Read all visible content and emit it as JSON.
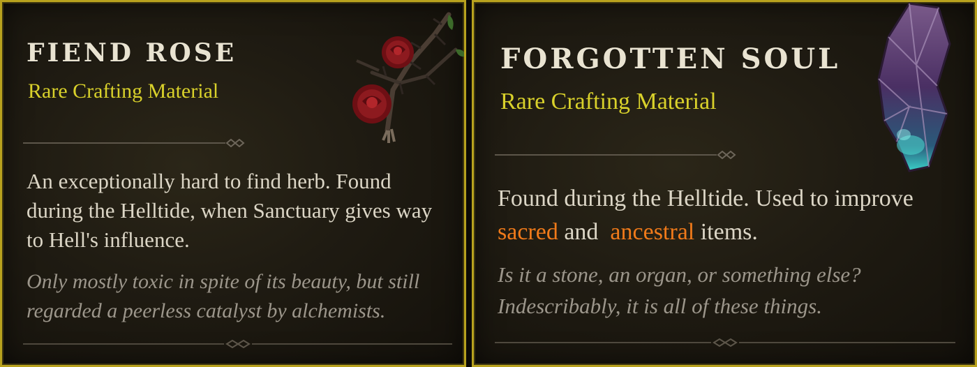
{
  "items": [
    {
      "title": "FIEND ROSE",
      "subtitle": "Rare Crafting Material",
      "description": "An exceptionally hard to find herb. Found during the Helltide, when Sanctuary gives way to Hell's influence.",
      "flavor": "Only mostly toxic in spite of its beauty, but still regarded a peerless catalyst by alchemists.",
      "icon": "fiend-rose-icon"
    },
    {
      "title": "FORGOTTEN SOUL",
      "subtitle": "Rare Crafting Material",
      "description_parts": {
        "before": "Found during the Helltide. Used to improve ",
        "highlight1": "sacred",
        "middle": " and  ",
        "highlight2": "ancestral",
        "after": " items."
      },
      "flavor": "Is it a stone, an organ, or something else? Indescribably, it is all of these things.",
      "icon": "forgotten-soul-icon"
    }
  ],
  "colors": {
    "border_gold": "#b8a21e",
    "rarity_yellow": "#d9d12b",
    "highlight_orange": "#f07a1a",
    "text_body": "#dcd6c6",
    "text_flavor": "#9c968b"
  }
}
